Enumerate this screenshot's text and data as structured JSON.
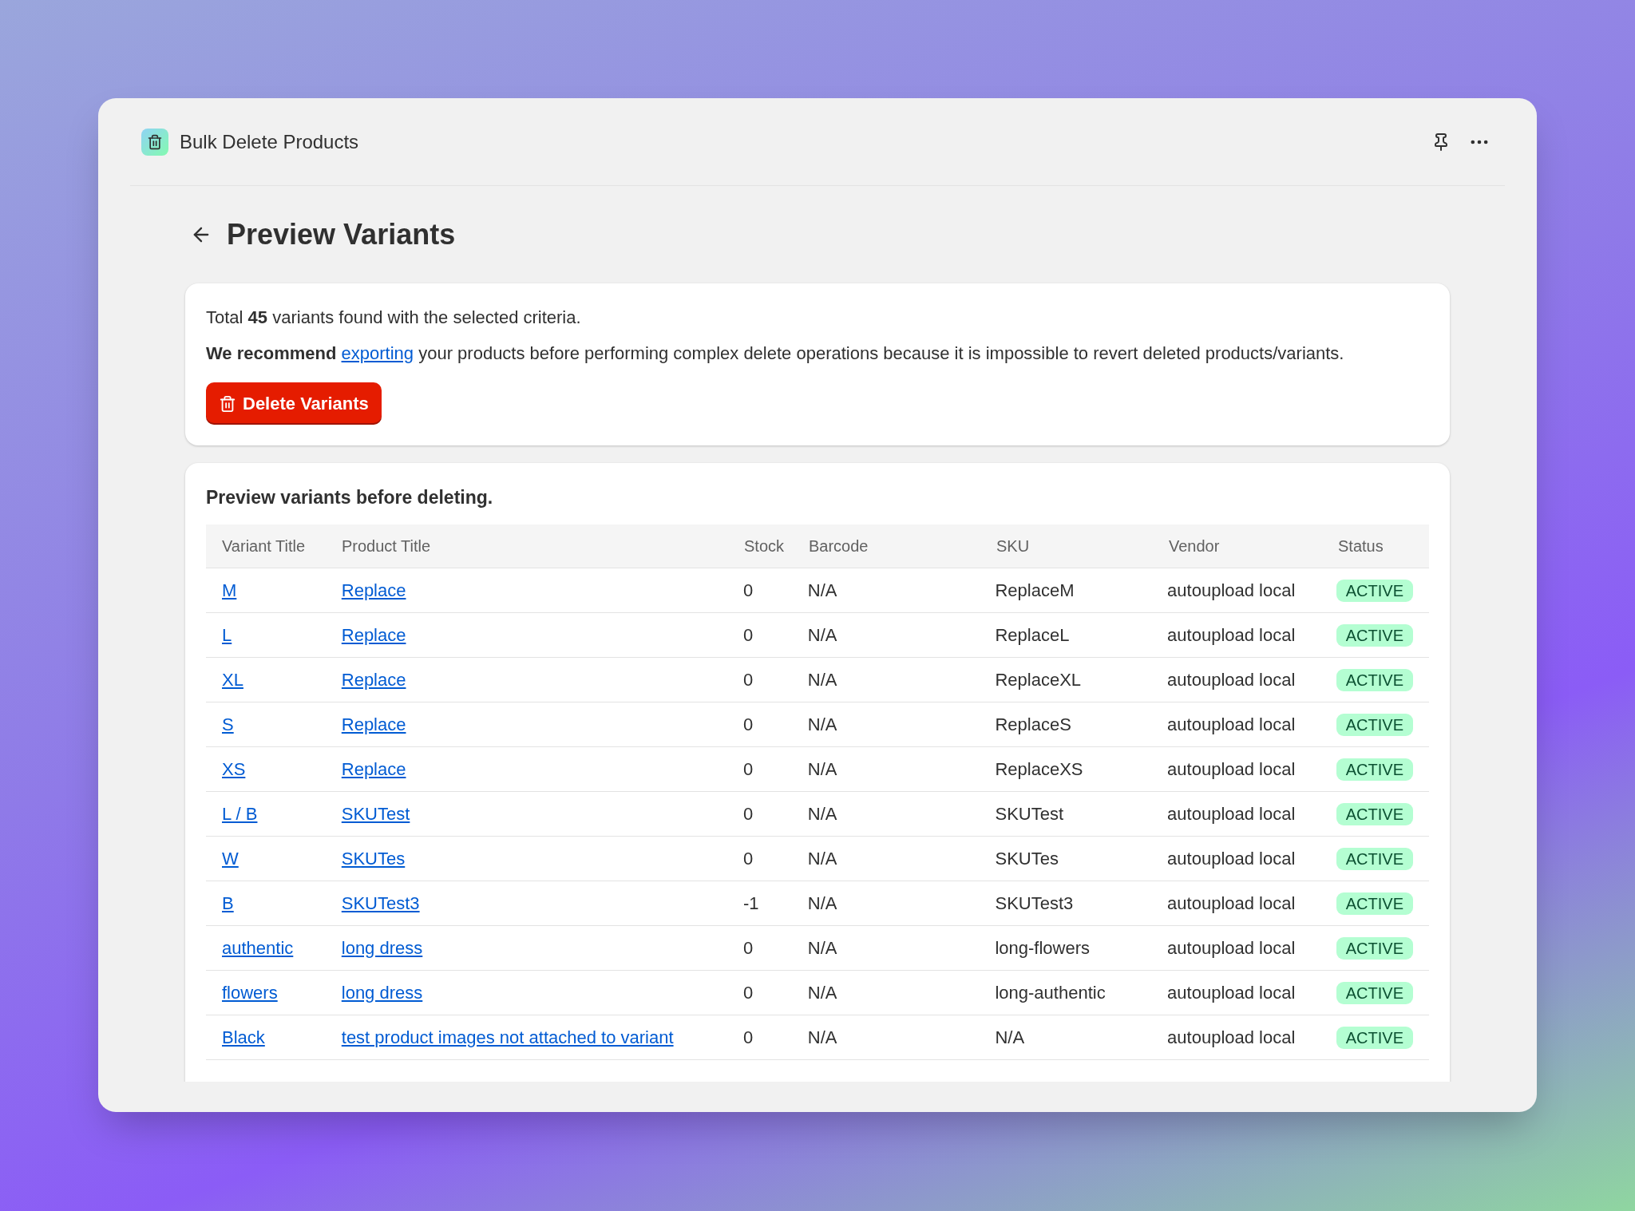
{
  "app": {
    "title": "Bulk Delete Products"
  },
  "page": {
    "title": "Preview Variants"
  },
  "summary": {
    "text": "Total **45** variants found with the selected criteria.",
    "warning_lead": "We recommend",
    "warning_link": "exporting",
    "warning_rest": "your products before performing complex delete operations because it is impossible to revert deleted products/variants.",
    "button": "Delete Variants"
  },
  "table": {
    "title": "Preview variants before deleting.",
    "columns": [
      "Variant Title",
      "Product Title",
      "Stock",
      "Barcode",
      "SKU",
      "Vendor",
      "Status"
    ],
    "rows": [
      {
        "variant": "M",
        "product": "Replace",
        "stock": "0",
        "barcode": "N/A",
        "sku": "ReplaceM",
        "vendor": "autoupload local",
        "status": "ACTIVE"
      },
      {
        "variant": "L",
        "product": "Replace",
        "stock": "0",
        "barcode": "N/A",
        "sku": "ReplaceL",
        "vendor": "autoupload local",
        "status": "ACTIVE"
      },
      {
        "variant": "XL",
        "product": "Replace",
        "stock": "0",
        "barcode": "N/A",
        "sku": "ReplaceXL",
        "vendor": "autoupload local",
        "status": "ACTIVE"
      },
      {
        "variant": "S",
        "product": "Replace",
        "stock": "0",
        "barcode": "N/A",
        "sku": "ReplaceS",
        "vendor": "autoupload local",
        "status": "ACTIVE"
      },
      {
        "variant": "XS",
        "product": "Replace",
        "stock": "0",
        "barcode": "N/A",
        "sku": "ReplaceXS",
        "vendor": "autoupload local",
        "status": "ACTIVE"
      },
      {
        "variant": "L / B",
        "product": "SKUTest",
        "stock": "0",
        "barcode": "N/A",
        "sku": "SKUTest",
        "vendor": "autoupload local",
        "status": "ACTIVE"
      },
      {
        "variant": "W",
        "product": "SKUTes",
        "stock": "0",
        "barcode": "N/A",
        "sku": "SKUTes",
        "vendor": "autoupload local",
        "status": "ACTIVE"
      },
      {
        "variant": "B",
        "product": "SKUTest3",
        "stock": "-1",
        "barcode": "N/A",
        "sku": "SKUTest3",
        "vendor": "autoupload local",
        "status": "ACTIVE"
      },
      {
        "variant": "authentic",
        "product": "long dress",
        "stock": "0",
        "barcode": "N/A",
        "sku": "long-flowers",
        "vendor": "autoupload local",
        "status": "ACTIVE"
      },
      {
        "variant": "flowers",
        "product": "long dress",
        "stock": "0",
        "barcode": "N/A",
        "sku": "long-authentic",
        "vendor": "autoupload local",
        "status": "ACTIVE"
      },
      {
        "variant": "Black",
        "product": "test product images not attached to variant",
        "stock": "0",
        "barcode": "N/A",
        "sku": "N/A",
        "vendor": "autoupload local",
        "status": "ACTIVE"
      }
    ]
  }
}
